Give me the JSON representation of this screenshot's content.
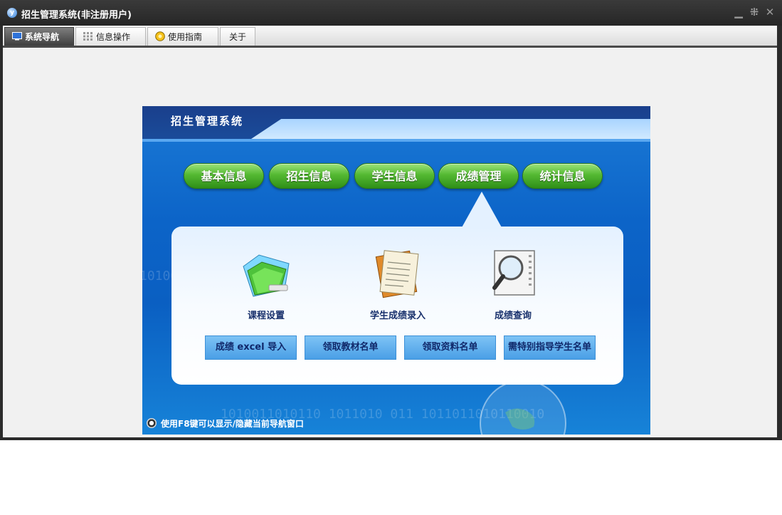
{
  "window": {
    "title": "招生管理系统(非注册用户)"
  },
  "menu": {
    "tabs": [
      {
        "label": "系统导航",
        "icon": "monitor-icon",
        "active": true
      },
      {
        "label": "信息操作",
        "icon": "grid-icon",
        "active": false
      },
      {
        "label": "使用指南",
        "icon": "help-icon",
        "active": false
      },
      {
        "label": "关于",
        "icon": "",
        "active": false
      }
    ]
  },
  "panel": {
    "title": "招生管理系统",
    "modules": [
      "基本信息",
      "招生信息",
      "学生信息",
      "成绩管理",
      "统计信息"
    ],
    "active_module": "成绩管理",
    "functions": [
      {
        "label": "课程设置",
        "icon": "folder-icon"
      },
      {
        "label": "学生成绩录入",
        "icon": "document-icon"
      },
      {
        "label": "成绩查询",
        "icon": "magnifier-icon"
      }
    ],
    "actions": [
      "成绩 excel 导入",
      "领取教材名单",
      "领取资料名单",
      "需特别指导学生名单"
    ],
    "background_text": "1010011010110   1011010  011   1011011010110010",
    "background_text_2": "10100",
    "footer_hint": "使用F8键可以显示/隐藏当前导航窗口"
  },
  "colors": {
    "accent_green": "#54b932",
    "panel_blue": "#0c64c8",
    "header_navy": "#1a3f8c"
  }
}
